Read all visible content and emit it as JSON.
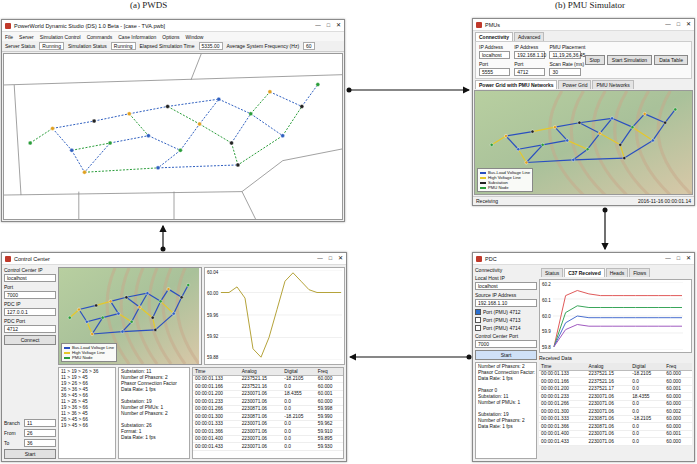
{
  "figure_labels": [
    {
      "text": "(a) PWDS"
    },
    {
      "text": "(b) PMU Simulator"
    }
  ],
  "window_controls": [
    "—",
    "□",
    "✕"
  ],
  "network": {
    "nodes": [
      [
        0.05,
        0.55
      ],
      [
        0.12,
        0.45
      ],
      [
        0.18,
        0.6
      ],
      [
        0.25,
        0.4
      ],
      [
        0.3,
        0.55
      ],
      [
        0.36,
        0.35
      ],
      [
        0.42,
        0.5
      ],
      [
        0.48,
        0.3
      ],
      [
        0.52,
        0.6
      ],
      [
        0.58,
        0.42
      ],
      [
        0.64,
        0.25
      ],
      [
        0.68,
        0.55
      ],
      [
        0.74,
        0.35
      ],
      [
        0.8,
        0.2
      ],
      [
        0.84,
        0.5
      ],
      [
        0.9,
        0.3
      ],
      [
        0.95,
        0.15
      ],
      [
        0.22,
        0.75
      ],
      [
        0.45,
        0.72
      ],
      [
        0.7,
        0.7
      ]
    ],
    "edges": [
      [
        0,
        1
      ],
      [
        1,
        2
      ],
      [
        1,
        3
      ],
      [
        2,
        4
      ],
      [
        3,
        5
      ],
      [
        4,
        6
      ],
      [
        5,
        6
      ],
      [
        5,
        7
      ],
      [
        6,
        8
      ],
      [
        7,
        9
      ],
      [
        8,
        9
      ],
      [
        9,
        10
      ],
      [
        9,
        11
      ],
      [
        10,
        12
      ],
      [
        11,
        12
      ],
      [
        12,
        13
      ],
      [
        12,
        14
      ],
      [
        13,
        15
      ],
      [
        14,
        15
      ],
      [
        15,
        16
      ],
      [
        2,
        17
      ],
      [
        17,
        18
      ],
      [
        8,
        18
      ],
      [
        18,
        19
      ],
      [
        11,
        19
      ],
      [
        4,
        17
      ],
      [
        7,
        10
      ],
      [
        14,
        19
      ]
    ]
  },
  "pwds": {
    "title": "PowerWorld Dynamic Studio (DS) 1.0 Beta - [case - TVA.pwb]",
    "menu": [
      "File",
      "Server",
      "Simulation Control",
      "Commands",
      "Case Information",
      "Options",
      "Window"
    ],
    "status": [
      {
        "label": "Server Status",
        "value": "Running"
      },
      {
        "label": "Simulation Status",
        "value": "Running"
      },
      {
        "label": "Elapsed Simulation Time",
        "value": "5335.00"
      },
      {
        "label": "Average System Frequency (Hz)",
        "value": "60"
      }
    ]
  },
  "pmu": {
    "title": "PMUs",
    "tabs": [
      {
        "label": "Connectivity",
        "selected": true
      },
      {
        "label": "Advanced",
        "selected": false
      }
    ],
    "fields": [
      {
        "label": "IP Address",
        "value": "localhost"
      },
      {
        "label": "Port",
        "value": "5555"
      },
      {
        "label": "IP Address",
        "value": "192.168.1.10"
      },
      {
        "label": "Port",
        "value": "4712"
      },
      {
        "label": "PMU Placement",
        "value": "11,19,26,36,45"
      },
      {
        "label": "Scan Rate (ms)",
        "value": "30"
      }
    ],
    "buttons": [
      "Stop",
      "Start Simulation",
      "Data Table"
    ],
    "views": [
      {
        "label": "Power Grid with PMU Networks",
        "selected": true
      },
      {
        "label": "Power Grid",
        "selected": false
      },
      {
        "label": "PMU Networks",
        "selected": false
      }
    ],
    "legend": [
      {
        "text": "Bus-Load Voltage Line",
        "color": "#2a4fc0"
      },
      {
        "text": "High Voltage Line",
        "color": "#e6c82a"
      },
      {
        "text": "Substation",
        "color": "#222222"
      },
      {
        "text": "PMU Node",
        "color": "#2a9d3a"
      }
    ],
    "status": "Receiving",
    "time": "2016-11-16 00:00:01.14"
  },
  "pdc": {
    "title": "PDC",
    "section": "Connectivity",
    "fields": [
      {
        "label": "Local Host IP",
        "value": "localhost"
      },
      {
        "label": "Source IP Address",
        "value": "192.168.1.10"
      }
    ],
    "ports": [
      {
        "label": "Port (PMU) 4712",
        "checked": true
      },
      {
        "label": "Port (PMU) 4713",
        "checked": false
      },
      {
        "label": "Port (PMU) 4714",
        "checked": false
      }
    ],
    "cc_label": "Control Center Port",
    "cc_value": "7000",
    "button": "Start",
    "log": [
      "Number of Phasors: 2",
      "Phasor Connection Factor:",
      "Data Rate: 1 fps",
      "",
      "Phasor 0",
      "Substation: 11",
      "Number of PMUs: 1",
      "",
      "Substation: 19",
      "Number of Phasors: 2",
      "Data Rate: 1 fps"
    ],
    "tabs": [
      {
        "label": "Status",
        "selected": false
      },
      {
        "label": "C37 Received",
        "selected": true
      },
      {
        "label": "Heads",
        "selected": false
      },
      {
        "label": "Flows",
        "selected": false
      }
    ],
    "chart": {
      "y_ticks": [
        "60.2",
        "60.1",
        "60.0",
        "59.9",
        "59.8"
      ],
      "series": [
        {
          "color": "#e05a5a",
          "values": [
            59.82,
            60.12,
            60.15,
            60.13,
            60.12,
            60.12,
            60.12,
            60.12,
            60.12,
            60.12,
            60.12,
            60.12
          ]
        },
        {
          "color": "#3aa65a",
          "values": [
            59.82,
            60.02,
            60.06,
            60.05,
            60.05,
            60.05,
            60.05,
            60.05,
            60.05,
            60.05,
            60.05,
            60.05
          ]
        },
        {
          "color": "#4a6fd0",
          "values": [
            59.82,
            59.96,
            60.0,
            59.99,
            59.99,
            59.99,
            59.99,
            59.99,
            59.99,
            59.99,
            59.99,
            59.99
          ]
        },
        {
          "color": "#a05ac0",
          "values": [
            59.82,
            59.92,
            59.95,
            59.94,
            59.94,
            59.94,
            59.94,
            59.94,
            59.94,
            59.94,
            59.94,
            59.94
          ]
        }
      ]
    },
    "table": {
      "caption": "Received Data",
      "columns": [
        "Time",
        "Analog",
        "Digital",
        "Freq"
      ],
      "rows": [
        [
          "00:00:01.133",
          "2237521.15",
          "-18.2105",
          "60.000"
        ],
        [
          "00:00:01.166",
          "2237521.16",
          "0.0",
          "60.000"
        ],
        [
          "00:00:01.200",
          "2237521.17",
          "0.0",
          "60.001"
        ],
        [
          "00:00:01.233",
          "2230071.06",
          "18.4355",
          "60.000"
        ],
        [
          "00:00:01.266",
          "2230071.06",
          "0.0",
          "60.000"
        ],
        [
          "00:00:01.300",
          "2230071.06",
          "0.0",
          "60.002"
        ],
        [
          "00:00:01.333",
          "2230871.06",
          "-18.2105",
          "60.000"
        ],
        [
          "00:00:01.366",
          "2230871.06",
          "0.0",
          "60.000"
        ],
        [
          "00:00:01.400",
          "2230071.06",
          "0.0",
          "60.001"
        ],
        [
          "00:00:01.433",
          "2230071.06",
          "0.0",
          "60.000"
        ]
      ]
    }
  },
  "ctrl": {
    "title": "Control Center",
    "fields": [
      {
        "label": "Control Center IP",
        "value": "localhost"
      },
      {
        "label": "Port",
        "value": "7000"
      },
      {
        "label": "PDC IP",
        "value": "127.0.0.1"
      },
      {
        "label": "PDC Port",
        "value": "4712"
      }
    ],
    "connect": "Connect",
    "controls": [
      {
        "label": "Branch",
        "value": "11"
      },
      {
        "label": "From",
        "value": "26"
      },
      {
        "label": "To",
        "value": "36"
      }
    ],
    "start": "Start",
    "legend": [
      {
        "text": "Bus-Load Voltage Line",
        "color": "#2a4fc0"
      },
      {
        "text": "High Voltage Line",
        "color": "#e6c82a"
      },
      {
        "text": "PMU Node",
        "color": "#2a9d3a"
      }
    ],
    "chart": {
      "y_ticks": [
        "60.04",
        "60.00",
        "59.96",
        "59.92",
        "59.88"
      ],
      "series": [
        {
          "color": "#b5a33a",
          "values": [
            60.0,
            60.0,
            60.01,
            59.99,
            59.9,
            59.885,
            59.92,
            59.97,
            60.02,
            60.035,
            60.02,
            60.005,
            60.0,
            60.0,
            60.0,
            60.0
          ]
        }
      ]
    },
    "list": [
      "11 > 19 > 26 > 36",
      "11 > 19 > 45",
      "19 > 26 > 66",
      "26 > 36 > 45",
      "36 > 45 > 66",
      "11 > 26 > 45",
      "19 > 36 > 66",
      "11 > 36 > 45",
      "26 > 45 > 66",
      "19 > 45 > 66"
    ],
    "log": [
      "Substation: 11",
      "Number of Phasors: 2",
      "Phasor Connection Factor",
      "Data Rate: 1 fps",
      "",
      "Substation: 19",
      "Number of PMUs: 1",
      "Number of Phasors: 2",
      "",
      "Substation: 26",
      "Format: 1",
      "Data Rate: 1 fps"
    ],
    "table": {
      "columns": [
        "Time",
        "Analog",
        "Digital",
        "Freq"
      ],
      "rows": [
        [
          "00:00:01.133",
          "2237521.15",
          "-18.2105",
          "60.000"
        ],
        [
          "00:00:01.166",
          "2237521.16",
          "0.0",
          "60.000"
        ],
        [
          "00:00:01.200",
          "2230071.06",
          "18.4355",
          "60.001"
        ],
        [
          "00:00:01.233",
          "2230071.06",
          "0.0",
          "60.000"
        ],
        [
          "00:00:01.266",
          "2230871.06",
          "0.0",
          "59.998"
        ],
        [
          "00:00:01.300",
          "2230871.06",
          "-18.2105",
          "59.990"
        ],
        [
          "00:00:01.333",
          "2230071.06",
          "0.0",
          "59.962"
        ],
        [
          "00:00:01.366",
          "2230071.06",
          "0.0",
          "59.910"
        ],
        [
          "00:00:01.400",
          "2230071.06",
          "0.0",
          "59.895"
        ],
        [
          "00:00:01.433",
          "2230071.06",
          "0.0",
          "59.930"
        ]
      ]
    }
  }
}
